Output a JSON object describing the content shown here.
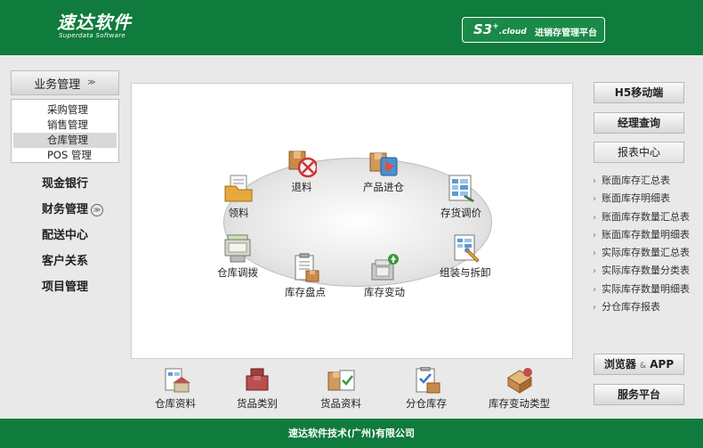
{
  "header": {
    "logo_cn": "速达软件",
    "logo_en": "Superdata Software",
    "product": "S3",
    "product_sup": "+",
    "product_suffix": ".cloud",
    "system_name": "进销存管理平台"
  },
  "nav": {
    "head_label": "业务管理",
    "submenu": [
      "采购管理",
      "销售管理",
      "仓库管理",
      "POS 管理"
    ],
    "active_sub": "仓库管理",
    "items": [
      "现金银行",
      "财务管理",
      "配送中心",
      "客户关系",
      "项目管理"
    ]
  },
  "functions": {
    "tuiliao": "退料",
    "chanpin_jincang": "产品进仓",
    "lingliao": "领料",
    "cunhuo_tiaojia": "存货调价",
    "cangku_tiaobo": "仓库调拨",
    "zuzhuang_chaixie": "组装与拆卸",
    "kucun_pandian": "库存盘点",
    "kucun_biandong": "库存变动"
  },
  "bottom": [
    "仓库资料",
    "货品类别",
    "货品资料",
    "分仓库存",
    "库存变动类型"
  ],
  "right": {
    "h5": "H5移动端",
    "manager": "经理查询",
    "report_center": "报表中心",
    "reports": [
      "账面库存汇总表",
      "账面库存明细表",
      "账面库存数量汇总表",
      "账面库存数量明细表",
      "实际库存数量汇总表",
      "实际库存数量分类表",
      "实际库存数量明细表",
      "分仓库存报表"
    ],
    "browser_app": "浏览器",
    "browser_amp": "&",
    "browser_app2": "APP",
    "service": "服务平台"
  },
  "footer": {
    "company": "速达软件技术(广州)有限公司"
  },
  "colors": {
    "brand_green": "#0f7b3c"
  }
}
